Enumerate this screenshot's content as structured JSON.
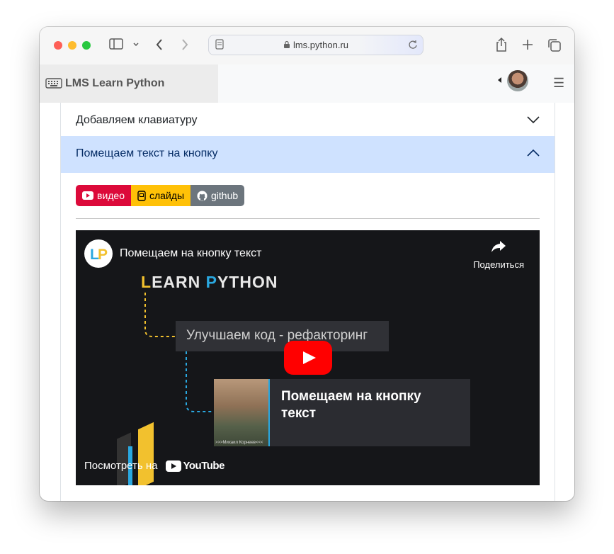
{
  "browser": {
    "url": "lms.python.ru"
  },
  "navbar": {
    "brand": "LMS Learn Python"
  },
  "accordion": {
    "item1": "Добавляем клавиатуру",
    "item2": "Помещаем текст на кнопку"
  },
  "buttons": {
    "video": "видео",
    "slides": "слайды",
    "github": "github"
  },
  "video": {
    "title": "Помещаем на кнопку текст",
    "share": "Поделиться",
    "brand_l": "L",
    "brand_earn": "EARN ",
    "brand_p": "P",
    "brand_ython": "YTHON",
    "prev_topic": "Улучшаем код - рефакторинг",
    "current_topic": "Помещаем на кнопку текст",
    "photo_caption": ">>>Михаил Корнеев<<<",
    "watch_on": "Посмотреть на",
    "youtube": "YouTube"
  },
  "colors": {
    "accent_active": "#cfe2ff",
    "video_btn": "#dc0a3a",
    "slides_btn": "#ffc107",
    "github_btn": "#6c757d"
  }
}
